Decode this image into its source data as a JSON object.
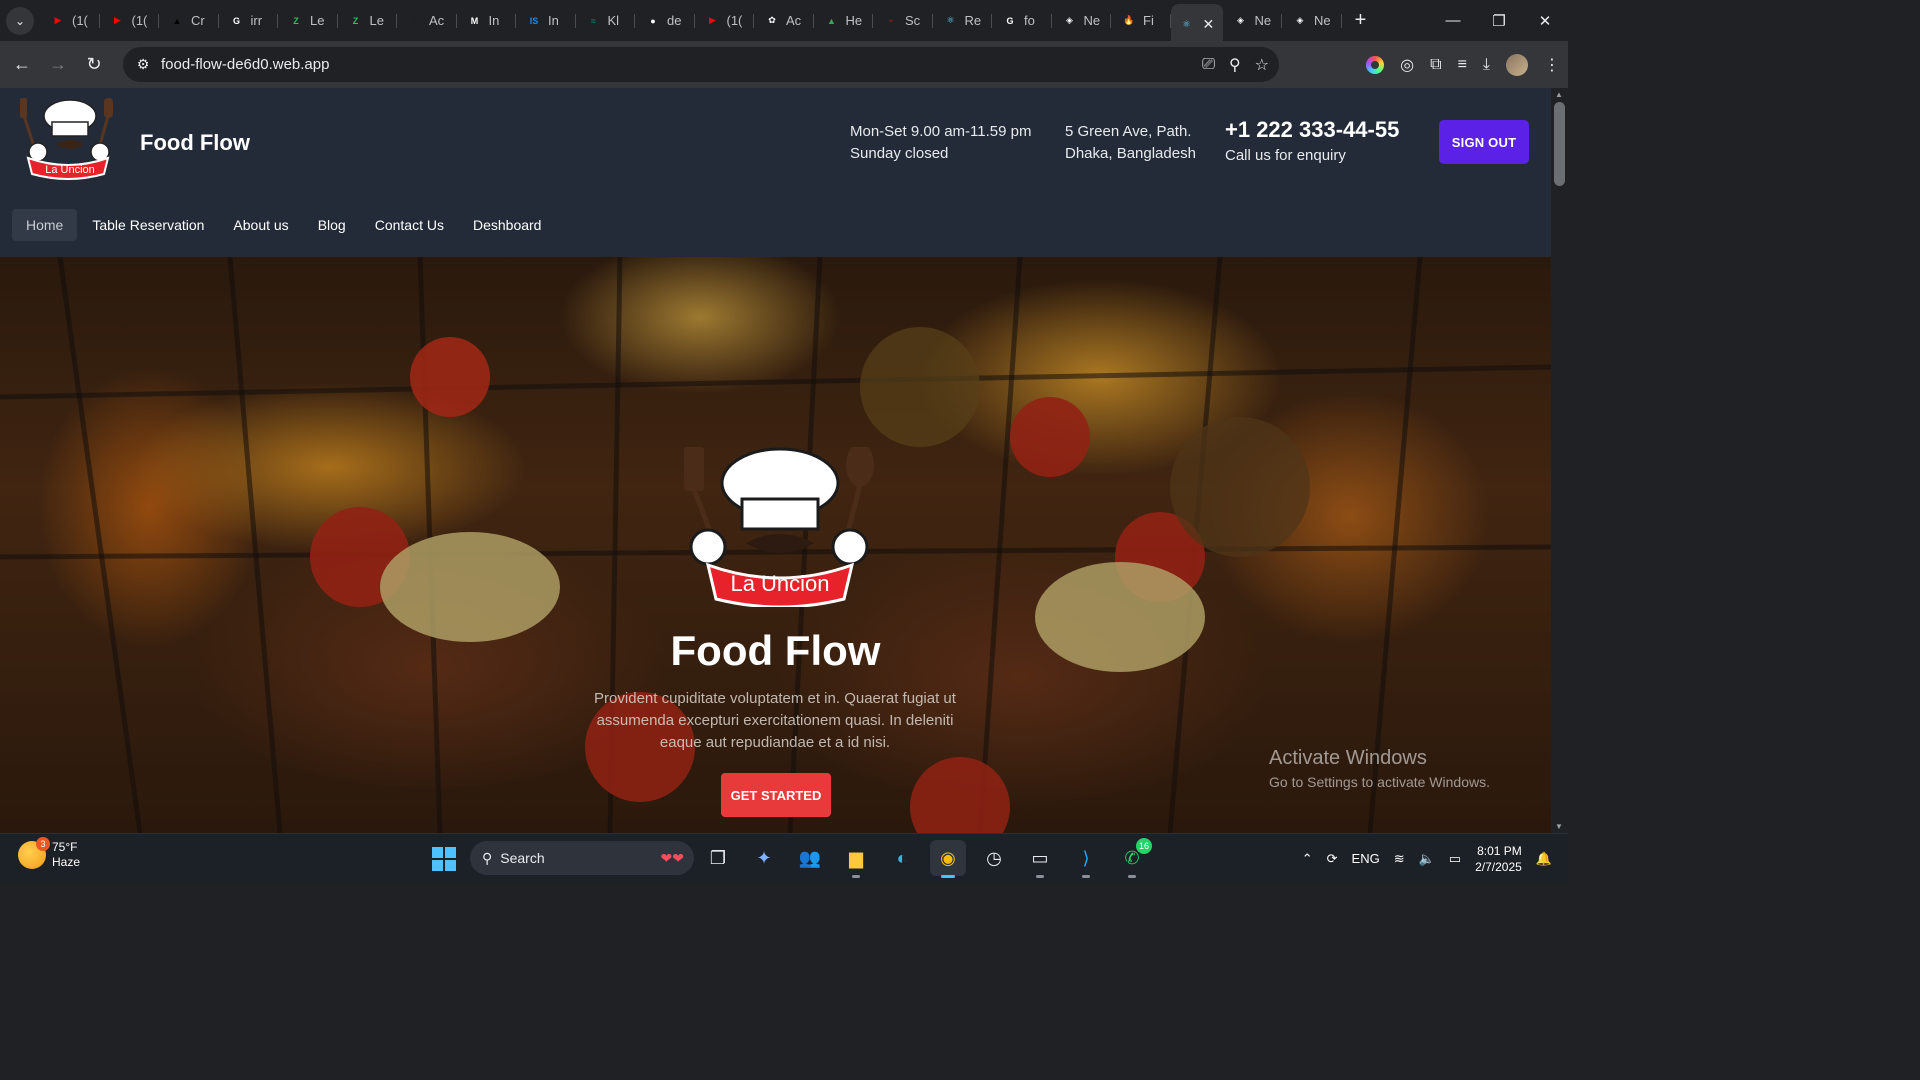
{
  "browser": {
    "tabs": [
      {
        "label": "(1(",
        "color": "#ff0000",
        "icon": "youtube-icon",
        "glyph": "▶"
      },
      {
        "label": "(1(",
        "color": "#ff0000",
        "icon": "youtube-icon",
        "glyph": "▶"
      },
      {
        "label": "Cr",
        "color": "#000000",
        "icon": "triangle-logo-icon",
        "glyph": "▲"
      },
      {
        "label": "irr",
        "color": "#ffffff",
        "icon": "google-icon",
        "glyph": "G"
      },
      {
        "label": "Le",
        "color": "#22c55e",
        "icon": "leaf-app-icon",
        "glyph": "Z"
      },
      {
        "label": "Le",
        "color": "#22c55e",
        "icon": "leaf-app-icon",
        "glyph": "Z"
      },
      {
        "label": "Ac",
        "color": "#202124",
        "icon": "pen-icon",
        "glyph": "⁄⁄"
      },
      {
        "label": "In",
        "color": "#ffffff",
        "icon": "gmail-icon",
        "glyph": "M"
      },
      {
        "label": "In",
        "color": "#1e88e5",
        "icon": "is-icon",
        "glyph": "IS"
      },
      {
        "label": "Kl",
        "color": "#0f766e",
        "icon": "kl-icon",
        "glyph": "≈"
      },
      {
        "label": "de",
        "color": "#ffffff",
        "icon": "github-icon",
        "glyph": "●"
      },
      {
        "label": "(1(",
        "color": "#ff0000",
        "icon": "youtube-icon",
        "glyph": "▶"
      },
      {
        "label": "Ac",
        "color": "#ffffff",
        "icon": "openai-icon",
        "glyph": "✿"
      },
      {
        "label": "He",
        "color": "#34a853",
        "icon": "drive-icon",
        "glyph": "▲"
      },
      {
        "label": "Sc",
        "color": "#7f1d1d",
        "icon": "sc-icon",
        "glyph": "◓"
      },
      {
        "label": "Re",
        "color": "#61dafb",
        "icon": "react-icon",
        "glyph": "⚛"
      },
      {
        "label": "fo",
        "color": "#ffffff",
        "icon": "google-icon",
        "glyph": "G"
      },
      {
        "label": "Ne",
        "color": "#ffffff",
        "icon": "netlify-icon",
        "glyph": "◈"
      },
      {
        "label": "Fi",
        "color": "#ff9100",
        "icon": "firebase-icon",
        "glyph": "🔥"
      }
    ],
    "active_tab": {
      "label": "",
      "icon": "react-icon",
      "glyph": "⚛",
      "color": "#61dafb"
    },
    "tabs_after": [
      {
        "label": "Ne",
        "color": "#ffffff",
        "icon": "netlify-icon",
        "glyph": "◈"
      },
      {
        "label": "Ne",
        "color": "#ffffff",
        "icon": "netlify-icon",
        "glyph": "◈"
      }
    ],
    "url": "food-flow-de6d0.web.app"
  },
  "site": {
    "brand": "Food Flow",
    "logo_text": "La Uncion",
    "hours_line1": "Mon-Set 9.00 am-11.59 pm",
    "hours_line2": "Sunday closed",
    "address_line1": "5 Green Ave, Path.",
    "address_line2": "Dhaka, Bangladesh",
    "phone": "+1 222 333-44-55",
    "phone_caption": "Call us for enquiry",
    "signout_label": "SIGN OUT",
    "nav": [
      "Home",
      "Table Reservation",
      "About us",
      "Blog",
      "Contact Us",
      "Deshboard"
    ],
    "hero": {
      "title": "Food Flow",
      "description": "Provident cupiditate voluptatem et in. Quaerat fugiat ut assumenda excepturi exercitationem quasi. In deleniti eaque aut repudiandae et a id nisi.",
      "cta": "GET STARTED",
      "logo_text": "La Uncion"
    },
    "colors": {
      "signout": "#5b21e6",
      "cta": "#e83a3a",
      "header": "#222b37"
    }
  },
  "watermark": {
    "line1": "Activate Windows",
    "line2": "Go to Settings to activate Windows."
  },
  "taskbar": {
    "weather_temp": "75°F",
    "weather_desc": "Haze",
    "weather_badge": "3",
    "search_placeholder": "Search",
    "whatsapp_badge": "16",
    "lang": "ENG",
    "time": "8:01 PM",
    "date": "2/7/2025"
  }
}
